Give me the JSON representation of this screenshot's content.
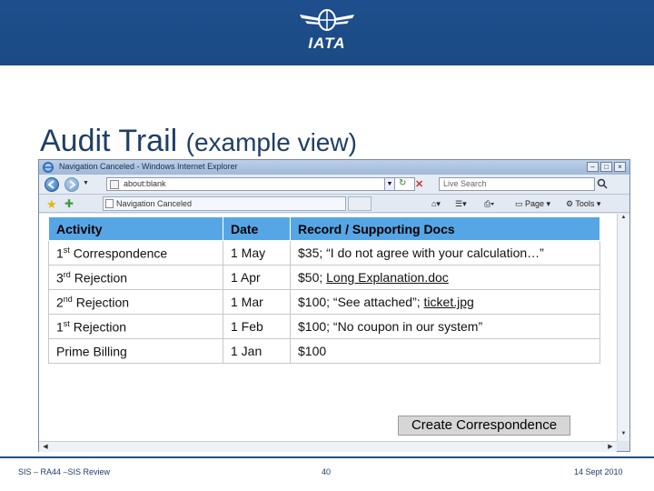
{
  "header": {
    "logo_text": "IATA",
    "brand_color": "#1e4f8c"
  },
  "slide": {
    "title_main": "Audit Trail",
    "title_sub": "(example view)"
  },
  "browser": {
    "window_title": "Navigation Canceled - Windows Internet Explorer",
    "address": "about:blank",
    "search_placeholder": "Live Search",
    "tab_label": "Navigation Canceled",
    "page_label": "Page",
    "tools_label": "Tools"
  },
  "table": {
    "headers": [
      "Activity",
      "Date",
      "Record / Supporting Docs"
    ],
    "header_color": "#56a6e6",
    "rows": [
      {
        "activity_num": "1",
        "activity_sup": "st",
        "activity_rest": " Correspondence",
        "date": "1 May",
        "record": "$35; “I do not agree with your calculation…”",
        "record_link": ""
      },
      {
        "activity_num": "3",
        "activity_sup": "rd",
        "activity_rest": " Rejection",
        "date": "1 Apr",
        "record": "$50; ",
        "record_link": "Long Explanation.doc"
      },
      {
        "activity_num": "2",
        "activity_sup": "nd",
        "activity_rest": " Rejection",
        "date": "1 Mar",
        "record": "$100; “See attached”; ",
        "record_link": "ticket.jpg"
      },
      {
        "activity_num": "1",
        "activity_sup": "st",
        "activity_rest": " Rejection",
        "date": "1 Feb",
        "record": "$100; “No coupon in our system”",
        "record_link": ""
      },
      {
        "activity_num": "Prime Billing",
        "activity_sup": "",
        "activity_rest": "",
        "date": "1 Jan",
        "record": "$100",
        "record_link": ""
      }
    ]
  },
  "actions": {
    "create_label": "Create Correspondence"
  },
  "footer": {
    "left": "SIS – RA44 –SIS Review",
    "center": "40",
    "right": "14 Sept 2010"
  }
}
